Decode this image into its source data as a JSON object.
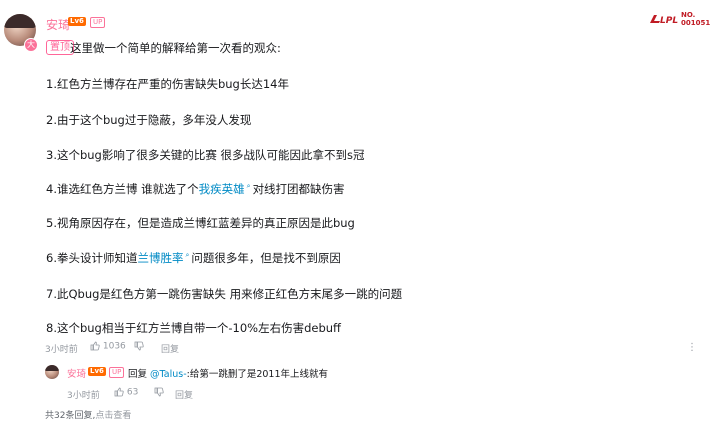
{
  "comment": {
    "username": "安琦",
    "level_badge": "Lv6",
    "up_badge": "UP",
    "avatar_badge": "大",
    "pinned_label": "置顶",
    "lines": [
      "这里做一个简单的解释给第一次看的观众:",
      "1.红色方兰博存在严重的伤害缺失bug长达14年",
      "2.由于这个bug过于隐蔽，多年没人发现",
      "3.这个bug影响了很多关键的比赛 很多战队可能因此拿不到s冠",
      "4.谁选红色方兰博 谁就选了个",
      "5.视角原因存在，但是造成兰博红蓝差异的真正原因是此bug",
      "6.拳头设计师知道",
      "7.此Qbug是红色方第一跳伤害缺失 用来修正红色方末尾多一跳的问题",
      "8.这个bug相当于红方兰博自带一个-10%左右伤害debuff"
    ],
    "line4_link": "我疾英雄",
    "line4_tail": "对线打团都缺伤害",
    "line6_link": "兰博胜率",
    "line6_tail": "问题很多年，但是找不到原因",
    "time": "3小时前",
    "likes": "1036",
    "reply_label": "回复"
  },
  "reply": {
    "username": "安琦",
    "level_badge": "Lv6",
    "up_badge": "UP",
    "prefix": "回复",
    "mention": "@Talus-",
    "text": ":给第一跳删了是2011年上线就有",
    "time": "3小时前",
    "likes": "63",
    "reply_label": "回复"
  },
  "summary": {
    "count_text": "共32条回复,",
    "view_text": "点击查看"
  },
  "watermark": {
    "brand": "LPL",
    "line1": "NO.",
    "line2": "001051"
  },
  "more_icon": "more-icon",
  "colors": {
    "username": "#fb7299",
    "link": "#008ac5",
    "level": "#ff6a00",
    "meta": "#9499a0"
  }
}
